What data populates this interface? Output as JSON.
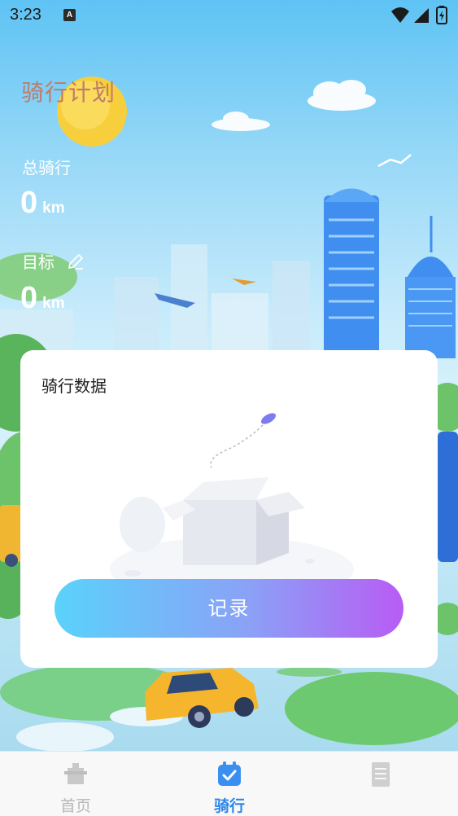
{
  "status_bar": {
    "time": "3:23",
    "notification_icon": "A",
    "icons": [
      "wifi-icon",
      "signal-icon",
      "battery-charging-icon"
    ]
  },
  "header": {
    "title": "骑行计划",
    "total_label": "总骑行",
    "total_value": "0",
    "total_unit": "km",
    "goal_label": "目标",
    "goal_value": "0",
    "goal_unit": "km",
    "edit_icon": "pencil-icon"
  },
  "card": {
    "title": "骑行数据",
    "empty_illustration": "empty-box-illustration",
    "record_button": "记录"
  },
  "tabbar": {
    "tabs": [
      {
        "label": "首页",
        "icon": "home-icon",
        "active": false
      },
      {
        "label": "骑行",
        "icon": "calendar-check-icon",
        "active": true
      },
      {
        "label": "",
        "icon": "document-icon",
        "active": false
      }
    ]
  },
  "colors": {
    "title": "#c07c6a",
    "active_tab": "#2e86e8",
    "inactive_tab": "#b7b7b7",
    "button_gradient_start": "#5ad2fb",
    "button_gradient_end": "#b85cf4"
  }
}
